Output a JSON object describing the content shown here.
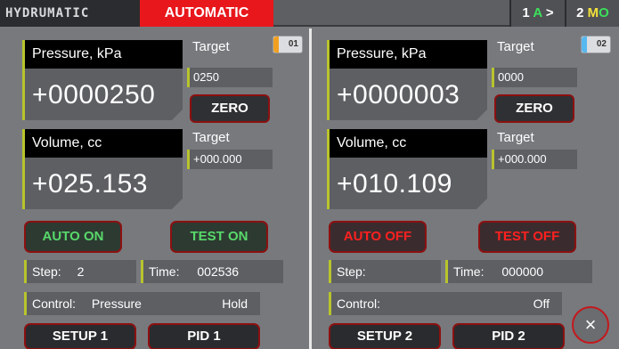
{
  "topbar": {
    "logo": "HYDRUMATIC",
    "mode": "AUTOMATIC",
    "channel1": {
      "num": "1",
      "letter": "A",
      "arrow": ">"
    },
    "channel2": {
      "num": "2",
      "letter1": "M",
      "letter2": "O"
    }
  },
  "left": {
    "tag": "01",
    "pressure": {
      "label": "Pressure, kPa",
      "value": "+0000250",
      "target_label": "Target",
      "target_value": "0250"
    },
    "zero_label": "ZERO",
    "volume": {
      "label": "Volume, cc",
      "value": "+025.153",
      "target_label": "Target",
      "target_value": "+000.000"
    },
    "auto_btn": "AUTO ON",
    "test_btn": "TEST ON",
    "step_label": "Step:",
    "step_value": "2",
    "time_label": "Time:",
    "time_value": "002536",
    "control_label": "Control:",
    "control_value": "Pressure",
    "control_mode": "Hold",
    "setup_btn": "SETUP 1",
    "pid_btn": "PID 1"
  },
  "right": {
    "tag": "02",
    "pressure": {
      "label": "Pressure, kPa",
      "value": "+0000003",
      "target_label": "Target",
      "target_value": "0000"
    },
    "zero_label": "ZERO",
    "volume": {
      "label": "Volume, cc",
      "value": "+010.109",
      "target_label": "Target",
      "target_value": "+000.000"
    },
    "auto_btn": "AUTO OFF",
    "test_btn": "TEST OFF",
    "step_label": "Step:",
    "step_value": "",
    "time_label": "Time:",
    "time_value": "000000",
    "control_label": "Control:",
    "control_value": "",
    "control_mode": "Off",
    "setup_btn": "SETUP 2",
    "pid_btn": "PID 2"
  },
  "close_icon": "×",
  "colors": {
    "mode_red": "#e8171c",
    "accent": "#b8c42c",
    "on_green": "#58d96a",
    "off_red": "#ff2020"
  }
}
